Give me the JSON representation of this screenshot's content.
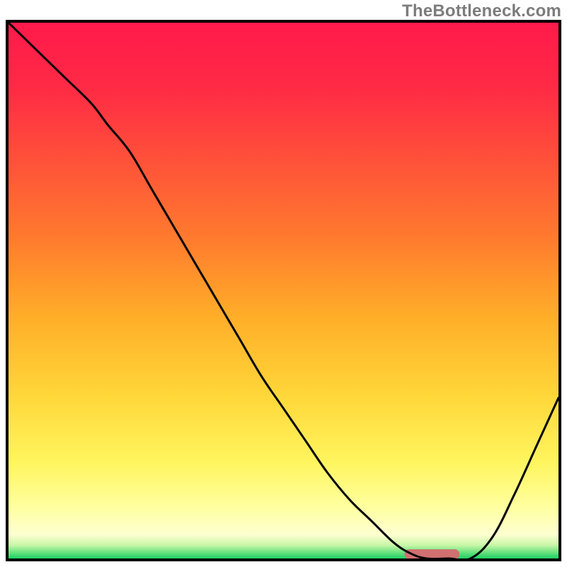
{
  "watermark": "TheBottleneck.com",
  "chart_data": {
    "type": "line",
    "title": "",
    "xlabel": "",
    "ylabel": "",
    "xlim": [
      0,
      100
    ],
    "ylim": [
      0,
      100
    ],
    "x": [
      0,
      5,
      10,
      15,
      18,
      22,
      26,
      30,
      34,
      38,
      42,
      46,
      50,
      54,
      58,
      62,
      66,
      70,
      73,
      76,
      80,
      84,
      88,
      92,
      96,
      100
    ],
    "values": [
      100,
      95,
      90,
      85,
      81,
      76,
      69,
      62,
      55,
      48,
      41,
      34,
      28,
      22,
      16,
      11,
      7,
      3,
      1,
      0,
      0,
      0,
      4,
      12,
      21,
      30
    ],
    "optimum_band": {
      "start_x": 72,
      "end_x": 82,
      "y": 0.8
    },
    "background_gradient": {
      "stops": [
        {
          "pos": 0.0,
          "color": "#ff1a4b"
        },
        {
          "pos": 0.12,
          "color": "#ff2a45"
        },
        {
          "pos": 0.25,
          "color": "#ff4f3a"
        },
        {
          "pos": 0.4,
          "color": "#ff7a2e"
        },
        {
          "pos": 0.55,
          "color": "#ffae28"
        },
        {
          "pos": 0.7,
          "color": "#ffd83a"
        },
        {
          "pos": 0.82,
          "color": "#fff55e"
        },
        {
          "pos": 0.9,
          "color": "#ffff9c"
        },
        {
          "pos": 0.955,
          "color": "#fdffd0"
        },
        {
          "pos": 0.975,
          "color": "#c9f7a8"
        },
        {
          "pos": 0.99,
          "color": "#5fe07a"
        },
        {
          "pos": 1.0,
          "color": "#1ecf63"
        }
      ]
    },
    "marker_color": "#d07070",
    "line_color": "#000000"
  }
}
